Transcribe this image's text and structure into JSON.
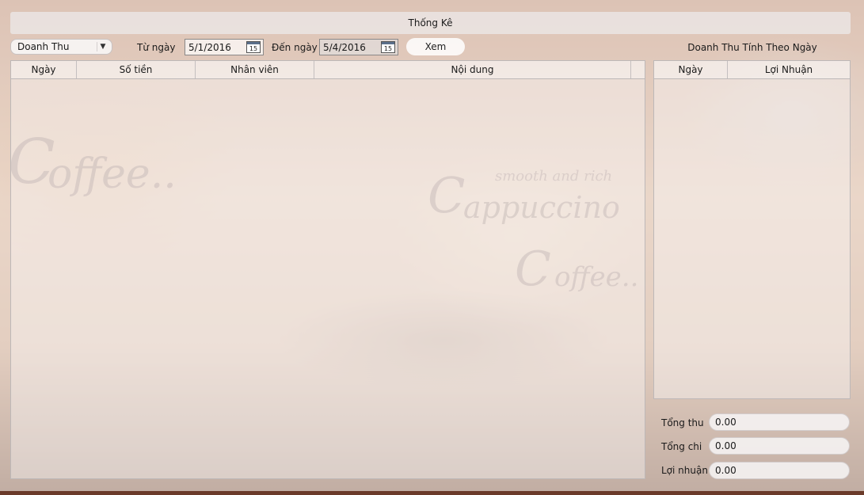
{
  "window": {
    "title": "Thống Kê"
  },
  "filter": {
    "report_type": "Doanh Thu",
    "from_label": "Từ ngày",
    "from_date": "5/1/2016",
    "to_label": "Đến ngày",
    "to_date": "5/4/2016",
    "calendar_day": "15",
    "view_button": "Xem"
  },
  "main_table": {
    "columns": [
      "Ngày",
      "Số tiền",
      "Nhân viên",
      "Nội dung"
    ],
    "rows": []
  },
  "side_panel": {
    "title": "Doanh Thu Tính Theo Ngày",
    "columns": [
      "Ngày",
      "Lợi Nhuận"
    ],
    "rows": []
  },
  "summary": {
    "total_income_label": "Tổng thu",
    "total_income": "0.00",
    "total_expense_label": "Tổng chi",
    "total_expense": "0.00",
    "profit_label": "Lợi nhuận",
    "profit": "0.00"
  }
}
